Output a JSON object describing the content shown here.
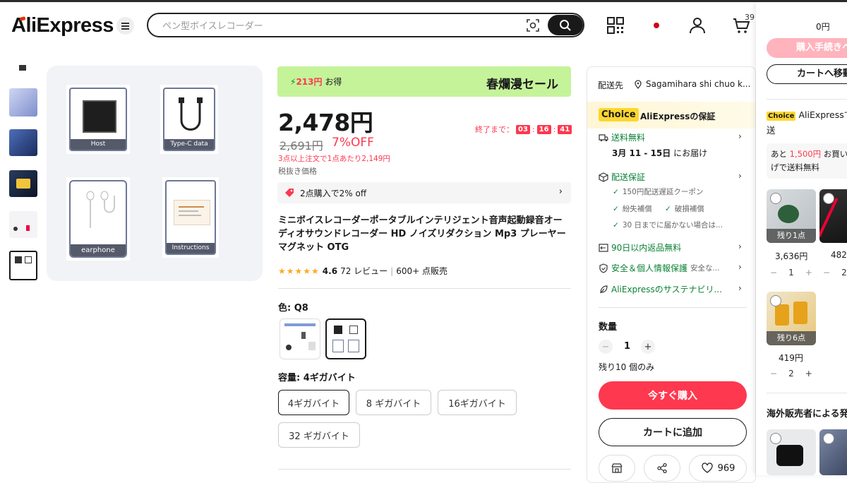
{
  "header": {
    "logo": "AliExpress",
    "search_placeholder": "ペン型ボイスレコーダー",
    "cart_count": "39"
  },
  "gallery": {
    "cards": [
      "Host",
      "Type-C data cable",
      "earphone",
      "Instructions"
    ]
  },
  "product": {
    "promo_save_amount": "213円",
    "promo_save_suffix": "お得",
    "promo_sale": "春爛漫セール",
    "price": "2,478円",
    "countdown_label": "終了まで：",
    "countdown": [
      "03",
      "16",
      "41"
    ],
    "original_price": "2,691円",
    "discount": "7%OFF",
    "bulk_note": "3点以上注文で1点あたり2,149円",
    "tax_note": "税抜き価格",
    "coupon": "2点購入で2% off",
    "title": "ミニボイスレコーダーポータブルインテリジェント音声起動録音オーディオサウンドレコーダー HD ノイズリダクション Mp3 プレーヤーマグネット OTG",
    "rating": "4.6",
    "reviews": "72 レビュー",
    "sold": "600+ 点販売",
    "color_label": "色: Q8",
    "capacity_label": "容量: 4ギガバイト",
    "capacity_options": [
      "4ギガバイト",
      "8 ギガバイト",
      "16ギガバイト",
      "32 ギガバイト"
    ]
  },
  "shipping": {
    "ship_to_label": "配送先",
    "address": "Sagamihara shi chuo k...",
    "choice_tag": "Choice",
    "choice_text": "AliExpressの保証",
    "free_shipping": "送料無料",
    "delivery_date": "3月 11 - 15日",
    "delivery_suffix": "にお届け",
    "guarantee": "配送保証",
    "guarantee_items": [
      "150円配送遅延クーポン",
      "紛失補償",
      "破損補償",
      "30 日までに届かない場合は..."
    ],
    "returns": "90日以内返品無料",
    "safety": "安全＆個人情報保護",
    "safety_sub": "安全な...",
    "sustain": "AliExpressのサステナビリ...",
    "qty_label": "数量",
    "qty": "1",
    "stock": "残り10 個のみ",
    "buy_now": "今すぐ購入",
    "add_cart": "カートに追加",
    "wishlist_count": "969"
  },
  "cart_sidebar": {
    "total": "0円",
    "checkout": "購入手続きへ",
    "go_cart": "カートへ移動",
    "choice_tag": "Choice",
    "choice_text": "AliExpressで送",
    "free_prefix": "あと ",
    "free_amount": "1,500円",
    "free_suffix": " お買い",
    "free_line2": "げで送料無料",
    "items": [
      {
        "badge": "残り1点",
        "price": "3,636円",
        "qty": "1"
      },
      {
        "badge": "",
        "price": "482",
        "qty": "2"
      },
      {
        "badge": "残り6点",
        "price": "419円",
        "qty": "2"
      }
    ],
    "section_title": "海外販売者による発"
  },
  "colors": {
    "accent": "#fd384f",
    "green": "#0b8235",
    "promo_bg": "#c5f39a",
    "choice_yellow": "#fdd72f"
  }
}
